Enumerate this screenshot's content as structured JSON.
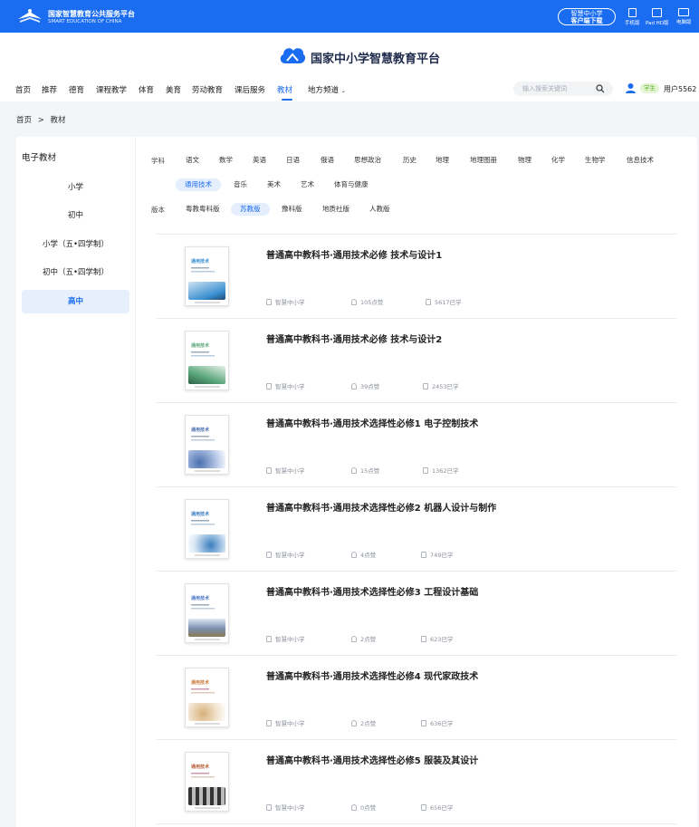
{
  "topbar": {
    "brand_cn": "国家智慧教育公共服务平台",
    "brand_en": "SMART EDUCATION OF CHINA",
    "download_line1": "智慧中小学",
    "download_line2": "客户端下载",
    "devices": [
      "手机版",
      "Pad HD版",
      "电脑版"
    ],
    "bg_color": "#1a6cf0"
  },
  "platform": {
    "title": "国家中小学智慧教育平台",
    "logo_icon": "cloud-book-logo"
  },
  "nav": {
    "items": [
      "首页",
      "推荐",
      "德育",
      "课程教学",
      "体育",
      "美育",
      "劳动教育",
      "课后服务",
      "教材",
      "地方频道"
    ],
    "active": "教材",
    "search_placeholder": "输入搜索关键词",
    "badge": "学生",
    "username": "用户5562"
  },
  "breadcrumb": {
    "home": "首页",
    "sep": ">",
    "current": "教材"
  },
  "sidebar": {
    "title": "电子教材",
    "items": [
      "小学",
      "初中",
      "小学（五•四学制）",
      "初中（五•四学制）",
      "高中"
    ],
    "active": "高中"
  },
  "filters": {
    "subject_label": "学科",
    "subjects_row1": [
      "语文",
      "数学",
      "英语",
      "日语",
      "俄语",
      "思想政治",
      "历史",
      "地理",
      "地理图册",
      "物理",
      "化学",
      "生物学",
      "信息技术"
    ],
    "subjects_row2": [
      "通用技术",
      "音乐",
      "美术",
      "艺术",
      "体育与健康"
    ],
    "selected_subject": "通用技术",
    "edition_label": "版本",
    "editions": [
      "粤教粤科版",
      "苏教版",
      "豫科版",
      "地质社版",
      "人教版"
    ],
    "selected_edition": "苏教版"
  },
  "books": [
    {
      "title": "普通高中教科书·通用技术必修 技术与设计1",
      "publisher": "智慧中小学",
      "likes": "105点赞",
      "learners": "5617已学",
      "cover_color": "#3a8fd0"
    },
    {
      "title": "普通高中教科书·通用技术必修 技术与设计2",
      "publisher": "智慧中小学",
      "likes": "39点赞",
      "learners": "2453已学",
      "cover_color": "#5aa67a"
    },
    {
      "title": "普通高中教科书·通用技术选择性必修1 电子控制技术",
      "publisher": "智慧中小学",
      "likes": "15点赞",
      "learners": "1362已学",
      "cover_color": "#4a6fb0"
    },
    {
      "title": "普通高中教科书·通用技术选择性必修2 机器人设计与制作",
      "publisher": "智慧中小学",
      "likes": "4点赞",
      "learners": "749已学",
      "cover_color": "#3a7fc0"
    },
    {
      "title": "普通高中教科书·通用技术选择性必修3 工程设计基础",
      "publisher": "智慧中小学",
      "likes": "2点赞",
      "learners": "623已学",
      "cover_color": "#4a79c8"
    },
    {
      "title": "普通高中教科书·通用技术选择性必修4 现代家政技术",
      "publisher": "智慧中小学",
      "likes": "2点赞",
      "learners": "636已学",
      "cover_color": "#c87a3a"
    },
    {
      "title": "普通高中教科书·通用技术选择性必修5 服装及其设计",
      "publisher": "智慧中小学",
      "likes": "0点赞",
      "learners": "656已学",
      "cover_color": "#b8603a"
    }
  ],
  "cover_text": "通用技术"
}
